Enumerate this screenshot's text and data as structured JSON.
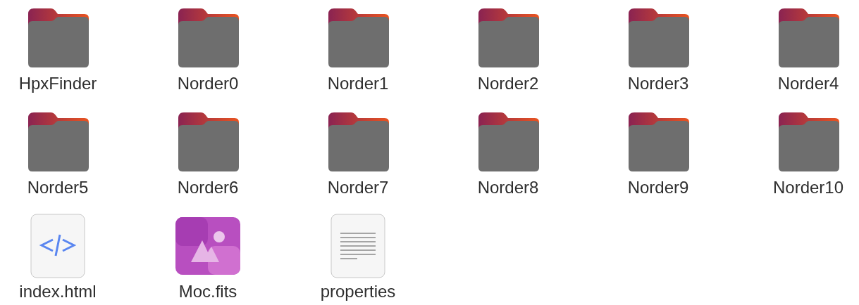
{
  "files": [
    {
      "name": "HpxFinder",
      "kind": "folder"
    },
    {
      "name": "Norder0",
      "kind": "folder"
    },
    {
      "name": "Norder1",
      "kind": "folder"
    },
    {
      "name": "Norder2",
      "kind": "folder"
    },
    {
      "name": "Norder3",
      "kind": "folder"
    },
    {
      "name": "Norder4",
      "kind": "folder"
    },
    {
      "name": "Norder5",
      "kind": "folder"
    },
    {
      "name": "Norder6",
      "kind": "folder"
    },
    {
      "name": "Norder7",
      "kind": "folder"
    },
    {
      "name": "Norder8",
      "kind": "folder"
    },
    {
      "name": "Norder9",
      "kind": "folder"
    },
    {
      "name": "Norder10",
      "kind": "folder"
    },
    {
      "name": "index.html",
      "kind": "html"
    },
    {
      "name": "Moc.fits",
      "kind": "image"
    },
    {
      "name": "properties",
      "kind": "text"
    }
  ]
}
